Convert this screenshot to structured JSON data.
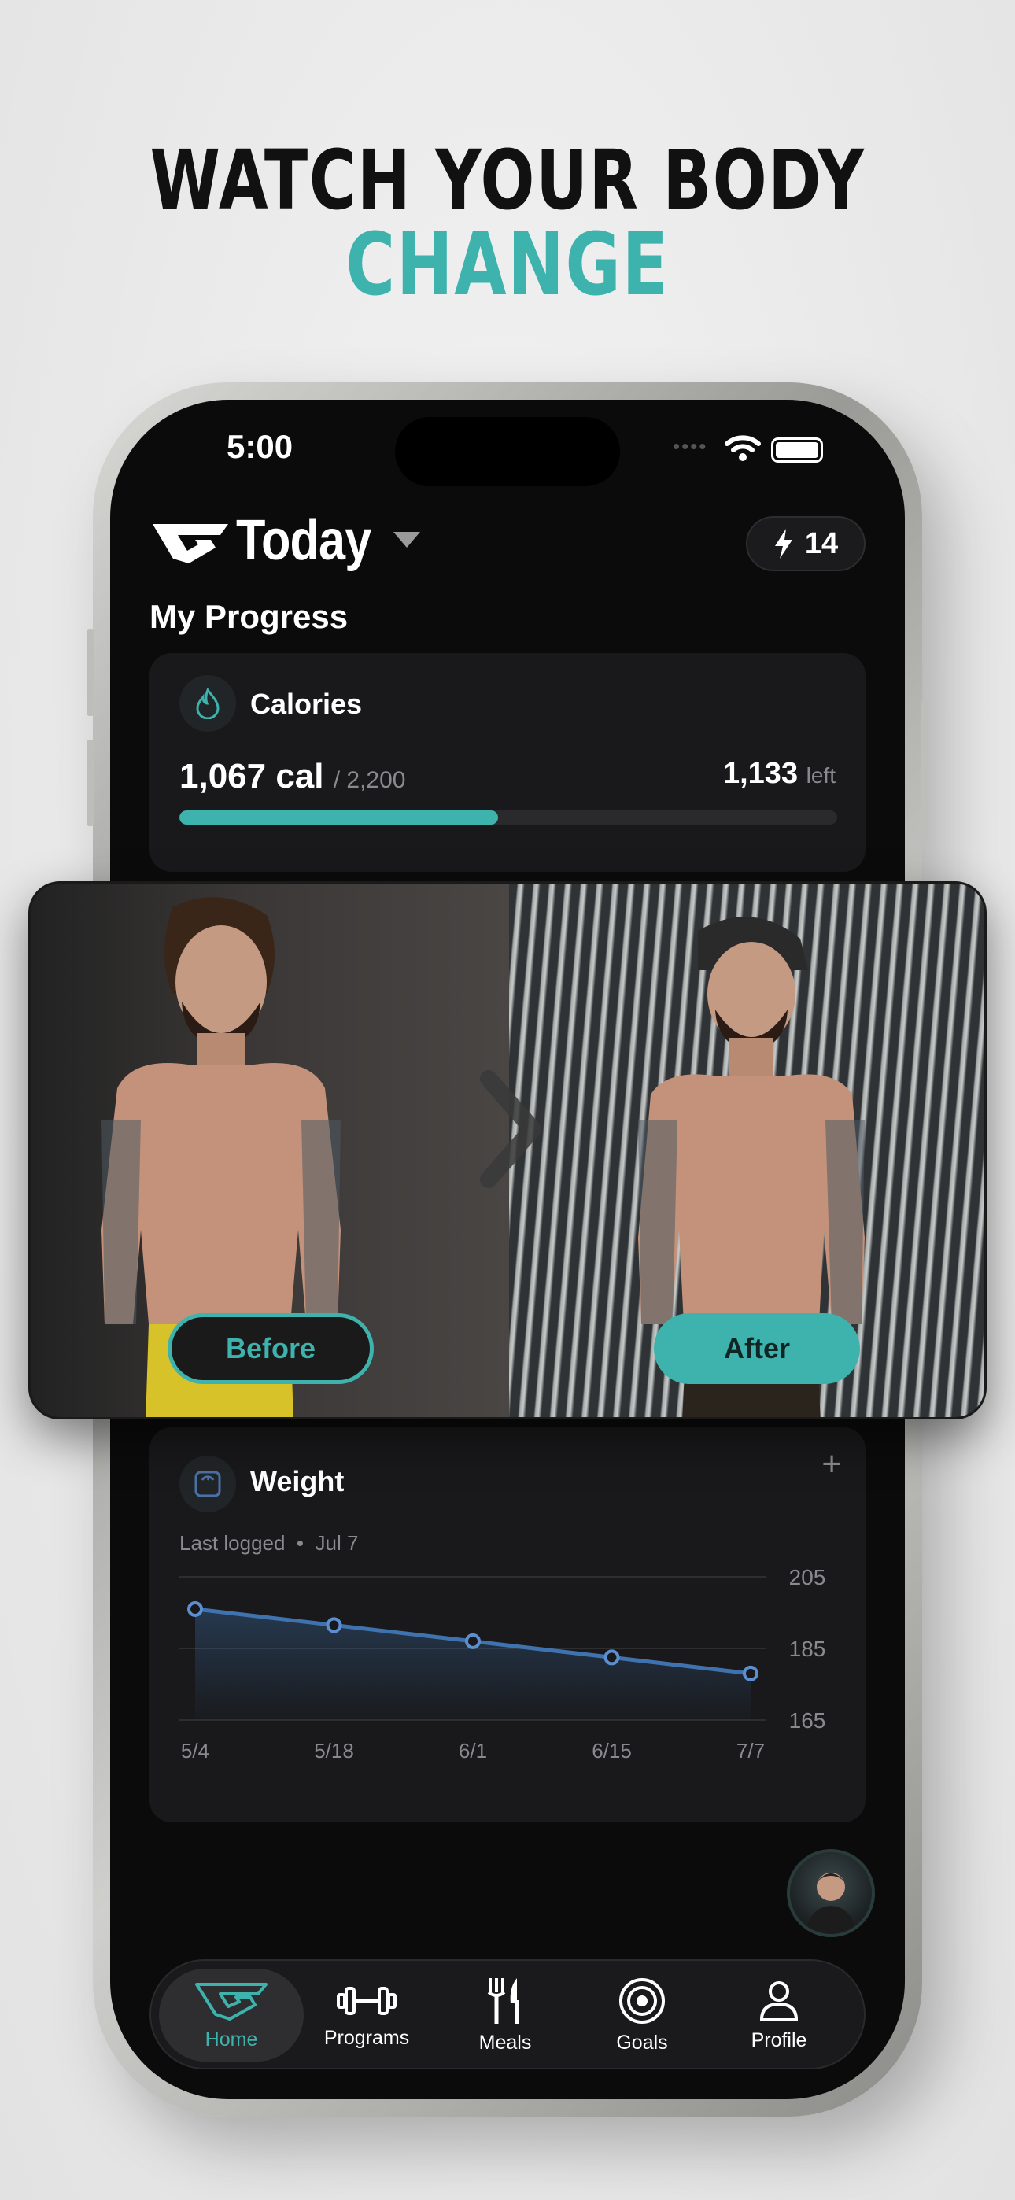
{
  "promo": {
    "headline_line1": "WATCH YOUR BODY",
    "headline_line2": "CHANGE"
  },
  "status_bar": {
    "time": "5:00"
  },
  "header": {
    "title": "Today",
    "streak_count": "14"
  },
  "progress": {
    "section_title": "My Progress",
    "calories": {
      "title": "Calories",
      "consumed": "1,067 cal",
      "goal": "/ 2,200",
      "remaining": "1,133",
      "remaining_label": "left",
      "fraction": 0.485
    },
    "weight": {
      "title": "Weight",
      "last_logged_label": "Last logged",
      "last_logged_date": "Jul 7"
    }
  },
  "comparison": {
    "before_label": "Before",
    "after_label": "After"
  },
  "chart_data": {
    "type": "line",
    "x": [
      "5/4",
      "5/18",
      "6/1",
      "6/15",
      "7/7"
    ],
    "series": [
      {
        "values": [
          196,
          191.5,
          187,
          182.5,
          178
        ]
      }
    ],
    "ylim": [
      165,
      205
    ],
    "yticks": [
      "205",
      "185",
      "165"
    ],
    "grid": true,
    "color": "#3f73b0"
  },
  "nav": {
    "items": [
      {
        "label": "Home",
        "icon": "home-logo-icon",
        "active": true
      },
      {
        "label": "Programs",
        "icon": "dumbbell-icon",
        "active": false
      },
      {
        "label": "Meals",
        "icon": "fork-knife-icon",
        "active": false
      },
      {
        "label": "Goals",
        "icon": "target-icon",
        "active": false
      },
      {
        "label": "Profile",
        "icon": "person-icon",
        "active": false
      }
    ]
  },
  "colors": {
    "accent": "#3eb3ad",
    "background": "#0b0b0c",
    "card": "#19191b",
    "chart_line": "#3f73b0"
  }
}
